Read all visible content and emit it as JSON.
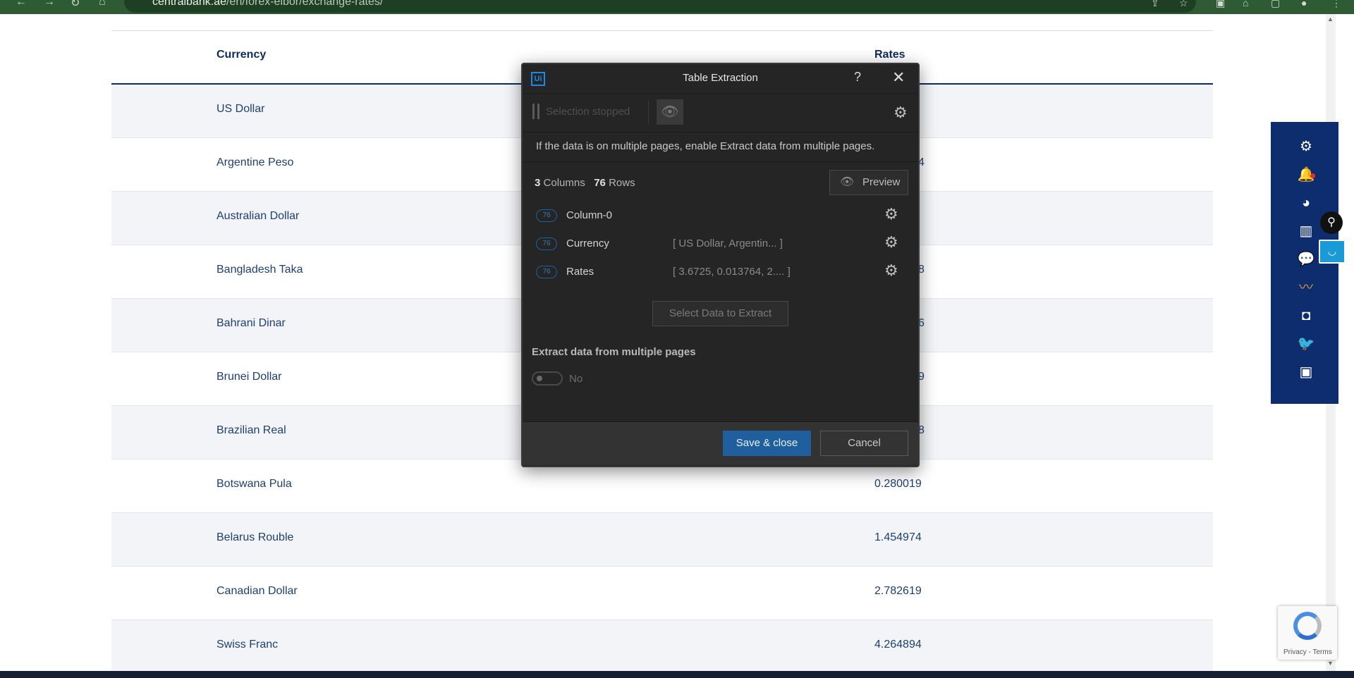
{
  "browser": {
    "url_host": "centralbank.ae",
    "url_path": "/en/forex-eibor/exchange-rates/"
  },
  "table": {
    "headers": [
      "Currency",
      "Rates"
    ],
    "rows": [
      {
        "currency": "US Dollar",
        "rate": ""
      },
      {
        "currency": "Argentine Peso",
        "rate": "4"
      },
      {
        "currency": "Australian Dollar",
        "rate": ""
      },
      {
        "currency": "Bangladesh Taka",
        "rate": "8"
      },
      {
        "currency": "Bahrani Dinar",
        "rate": "6"
      },
      {
        "currency": "Brunei Dollar",
        "rate": "9"
      },
      {
        "currency": "Brazilian Real",
        "rate": "8"
      },
      {
        "currency": "Botswana Pula",
        "rate": "0.280019"
      },
      {
        "currency": "Belarus Rouble",
        "rate": "1.454974"
      },
      {
        "currency": "Canadian Dollar",
        "rate": "2.782619"
      },
      {
        "currency": "Swiss Franc",
        "rate": "4.264894"
      }
    ]
  },
  "dialog": {
    "logo": "Ui",
    "title": "Table Extraction",
    "help": "?",
    "close": "✕",
    "selection_status": "Selection stopped",
    "info": "If the data is on multiple pages, enable Extract data from multiple pages.",
    "columns_count": "3",
    "columns_label": "Columns",
    "rows_count": "76",
    "rows_label": "Rows",
    "preview_label": "Preview",
    "columns": [
      {
        "count": "76",
        "name": "Column-0",
        "preview": ""
      },
      {
        "count": "76",
        "name": "Currency",
        "preview": "[ US Dollar, Argentin... ]"
      },
      {
        "count": "76",
        "name": "Rates",
        "preview": "[ 3.6725, 0.013764, 2.... ]"
      }
    ],
    "select_data_label": "Select Data to Extract",
    "multi_pages_label": "Extract data from multiple pages",
    "toggle_value": "No",
    "save_label": "Save & close",
    "cancel_label": "Cancel"
  },
  "recaptcha": {
    "terms": "Privacy - Terms"
  },
  "icons": {
    "accent": "#1e88e5",
    "sidebar_bg": "#0e2d6e"
  }
}
